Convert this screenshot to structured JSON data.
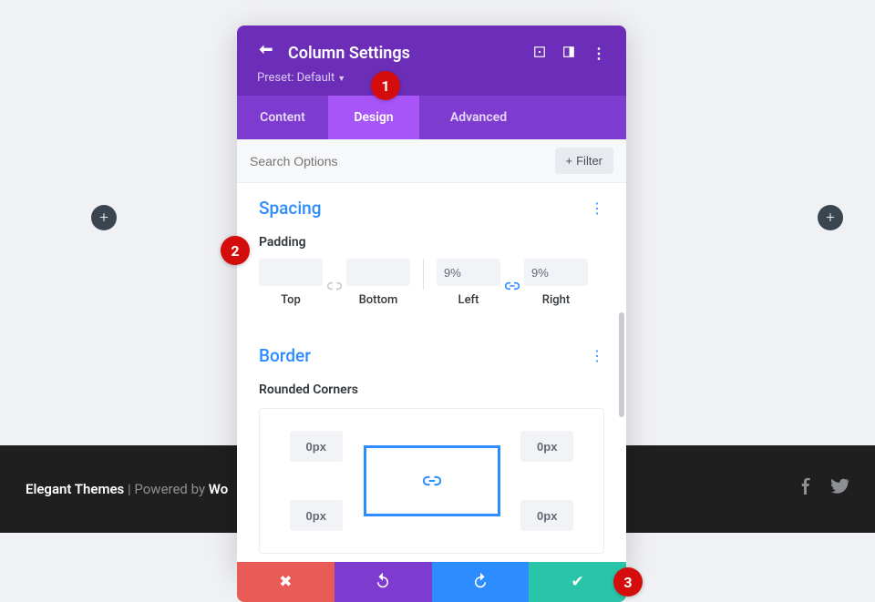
{
  "footer": {
    "brand": "Elegant Themes",
    "sep": " | Powered by ",
    "platform": "Wo"
  },
  "plus": {
    "glyph": "+"
  },
  "modal": {
    "title": "Column Settings",
    "preset_label": "Preset: Default",
    "tabs": {
      "content": "Content",
      "design": "Design",
      "advanced": "Advanced"
    },
    "search_placeholder": "Search Options",
    "filter_label": "Filter"
  },
  "spacing": {
    "title": "Spacing",
    "padding_label": "Padding",
    "top_label": "Top",
    "bottom_label": "Bottom",
    "left_label": "Left",
    "right_label": "Right",
    "top_value": "",
    "bottom_value": "",
    "left_value": "9%",
    "right_value": "9%"
  },
  "border": {
    "title": "Border",
    "rounded_label": "Rounded Corners",
    "tl": "0px",
    "tr": "0px",
    "bl": "0px",
    "br": "0px"
  },
  "badges": {
    "b1": "1",
    "b2": "2",
    "b3": "3"
  }
}
